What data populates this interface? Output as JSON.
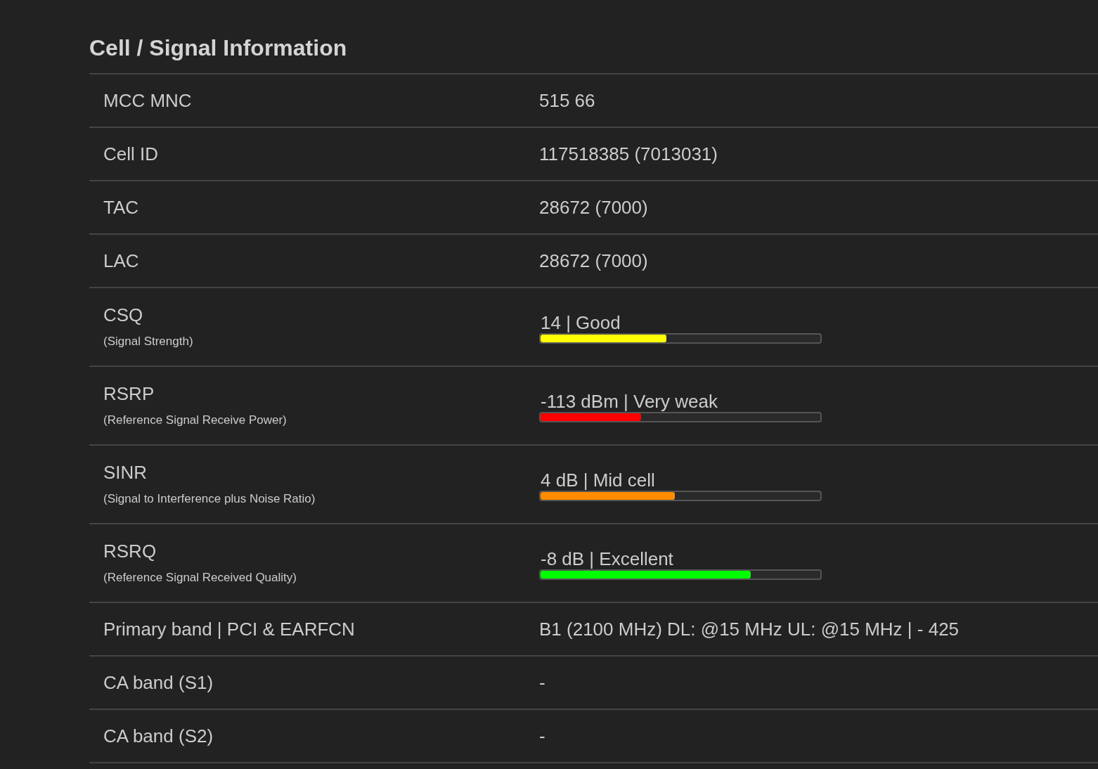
{
  "section": {
    "title": "Cell / Signal Information"
  },
  "rows": [
    {
      "kind": "text",
      "label": "MCC MNC",
      "value": "515 66"
    },
    {
      "kind": "text",
      "label": "Cell ID",
      "value": "117518385 (7013031)"
    },
    {
      "kind": "text",
      "label": "TAC",
      "value": "28672 (7000)"
    },
    {
      "kind": "text",
      "label": "LAC",
      "value": "28672 (7000)"
    },
    {
      "kind": "meter",
      "label": "CSQ",
      "sublabel": "(Signal Strength)",
      "reading": "14 | Good",
      "level": 0.45,
      "color": "#ffff00"
    },
    {
      "kind": "meter",
      "label": "RSRP",
      "sublabel": "(Reference Signal Receive Power)",
      "reading": "-113 dBm | Very weak",
      "level": 0.36,
      "color": "#ff0000"
    },
    {
      "kind": "meter",
      "label": "SINR",
      "sublabel": "(Signal to Interference plus Noise Ratio)",
      "reading": "4 dB | Mid cell",
      "level": 0.48,
      "color": "#ff8c00"
    },
    {
      "kind": "meter",
      "label": "RSRQ",
      "sublabel": "(Reference Signal Received Quality)",
      "reading": "-8 dB | Excellent",
      "level": 0.75,
      "color": "#00ff00"
    },
    {
      "kind": "text",
      "label": "Primary band | PCI & EARFCN",
      "value": "B1 (2100 MHz) DL: @15 MHz UL: @15 MHz | - 425"
    },
    {
      "kind": "text",
      "label": "CA band (S1)",
      "value": "-"
    },
    {
      "kind": "text",
      "label": "CA band (S2)",
      "value": "-"
    }
  ]
}
